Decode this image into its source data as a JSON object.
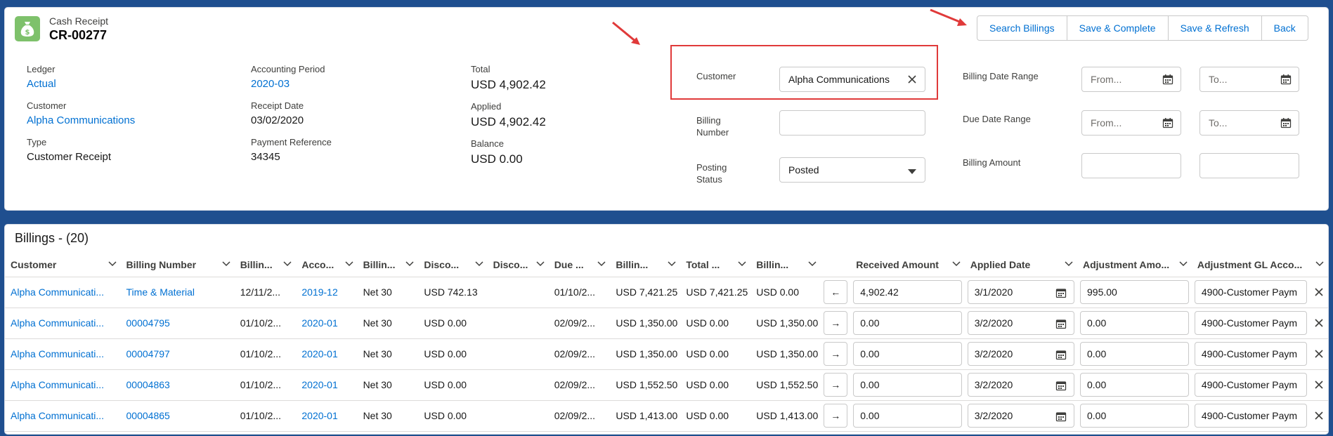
{
  "record": {
    "object_label": "Cash Receipt",
    "name": "CR-00277",
    "icon": "money-bag-icon"
  },
  "actions": [
    {
      "name": "search-billings-button",
      "label": "Search Billings"
    },
    {
      "name": "save-complete-button",
      "label": "Save & Complete"
    },
    {
      "name": "save-refresh-button",
      "label": "Save & Refresh"
    },
    {
      "name": "back-button",
      "label": "Back"
    }
  ],
  "details": {
    "ledger": {
      "label": "Ledger",
      "value": "Actual"
    },
    "customer": {
      "label": "Customer",
      "value": "Alpha Communications"
    },
    "type": {
      "label": "Type",
      "value": "Customer Receipt"
    },
    "accounting_period": {
      "label": "Accounting Period",
      "value": "2020-03"
    },
    "receipt_date": {
      "label": "Receipt Date",
      "value": "03/02/2020"
    },
    "payment_reference": {
      "label": "Payment Reference",
      "value": "34345"
    },
    "total": {
      "label": "Total",
      "value": "USD 4,902.42"
    },
    "applied": {
      "label": "Applied",
      "value": "USD 4,902.42"
    },
    "balance": {
      "label": "Balance",
      "value": "USD 0.00"
    }
  },
  "filters": {
    "customer": {
      "label": "Customer",
      "value": "Alpha Communications"
    },
    "billing_number": {
      "label": "Billing Number",
      "value": ""
    },
    "posting_status": {
      "label": "Posting Status",
      "value": "Posted"
    },
    "billing_date_range": {
      "label": "Billing Date Range",
      "from_placeholder": "From...",
      "to_placeholder": "To..."
    },
    "due_date_range": {
      "label": "Due Date Range",
      "from_placeholder": "From...",
      "to_placeholder": "To..."
    },
    "billing_amount": {
      "label": "Billing Amount",
      "from": "",
      "to": ""
    }
  },
  "billings": {
    "title": "Billings - (20)",
    "columns": [
      "Customer",
      "Billing Number",
      "Billin...",
      "Acco...",
      "Billin...",
      "Disco...",
      "Disco...",
      "Due ...",
      "Billin...",
      "Total ...",
      "Billin...",
      "",
      "Received Amount",
      "Applied Date",
      "Adjustment Amo...",
      "Adjustment GL Acco..."
    ],
    "rows": [
      {
        "customer": "Alpha Communicati...",
        "billing_number": "Time & Material",
        "billing_date": "12/11/2...",
        "period": "2019-12",
        "terms": "Net 30",
        "discount_amt": "USD 742.13",
        "discount_date": "",
        "due_date": "01/10/2...",
        "billing_amount": "USD 7,421.25",
        "total": "USD 7,421.25",
        "balance": "USD 0.00",
        "arrow": "←",
        "received": "4,902.42",
        "applied_date": "3/1/2020",
        "adjustment": "995.00",
        "gl_account": "4900-Customer Paym"
      },
      {
        "customer": "Alpha Communicati...",
        "billing_number": "00004795",
        "billing_date": "01/10/2...",
        "period": "2020-01",
        "terms": "Net 30",
        "discount_amt": "USD 0.00",
        "discount_date": "",
        "due_date": "02/09/2...",
        "billing_amount": "USD 1,350.00",
        "total": "USD 0.00",
        "balance": "USD 1,350.00",
        "arrow": "→",
        "received": "0.00",
        "applied_date": "3/2/2020",
        "adjustment": "0.00",
        "gl_account": "4900-Customer Paym"
      },
      {
        "customer": "Alpha Communicati...",
        "billing_number": "00004797",
        "billing_date": "01/10/2...",
        "period": "2020-01",
        "terms": "Net 30",
        "discount_amt": "USD 0.00",
        "discount_date": "",
        "due_date": "02/09/2...",
        "billing_amount": "USD 1,350.00",
        "total": "USD 0.00",
        "balance": "USD 1,350.00",
        "arrow": "→",
        "received": "0.00",
        "applied_date": "3/2/2020",
        "adjustment": "0.00",
        "gl_account": "4900-Customer Paym"
      },
      {
        "customer": "Alpha Communicati...",
        "billing_number": "00004863",
        "billing_date": "01/10/2...",
        "period": "2020-01",
        "terms": "Net 30",
        "discount_amt": "USD 0.00",
        "discount_date": "",
        "due_date": "02/09/2...",
        "billing_amount": "USD 1,552.50",
        "total": "USD 0.00",
        "balance": "USD 1,552.50",
        "arrow": "→",
        "received": "0.00",
        "applied_date": "3/2/2020",
        "adjustment": "0.00",
        "gl_account": "4900-Customer Paym"
      },
      {
        "customer": "Alpha Communicati...",
        "billing_number": "00004865",
        "billing_date": "01/10/2...",
        "period": "2020-01",
        "terms": "Net 30",
        "discount_amt": "USD 0.00",
        "discount_date": "",
        "due_date": "02/09/2...",
        "billing_amount": "USD 1,413.00",
        "total": "USD 0.00",
        "balance": "USD 1,413.00",
        "arrow": "→",
        "received": "0.00",
        "applied_date": "3/2/2020",
        "adjustment": "0.00",
        "gl_account": "4900-Customer Paym"
      }
    ]
  },
  "colors": {
    "link": "#0070d2",
    "annotation": "#e03a3a",
    "record_icon": "#7ec16b"
  }
}
